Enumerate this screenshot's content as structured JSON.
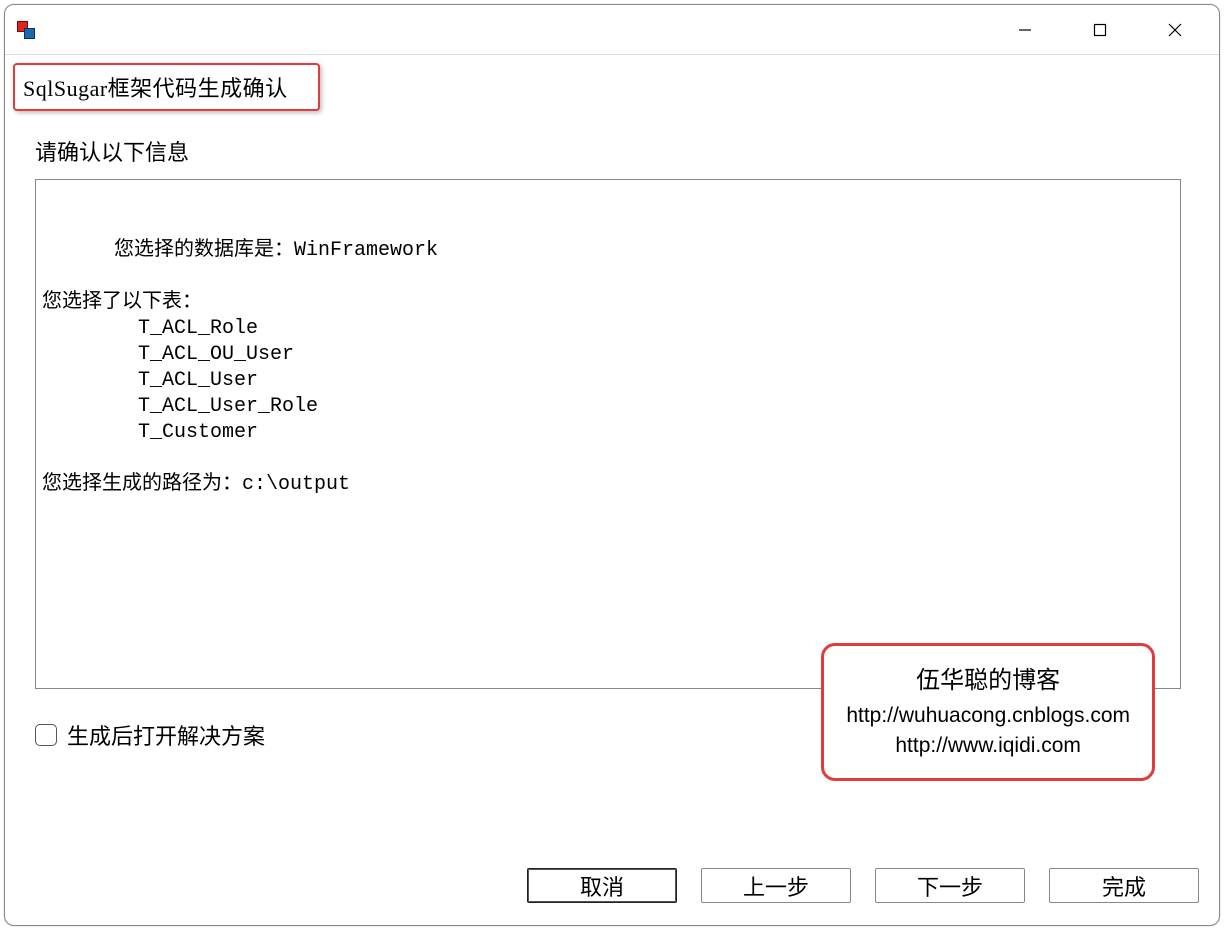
{
  "window": {
    "title": "SqlSugar框架代码生成确认"
  },
  "main": {
    "confirm_label": "请确认以下信息",
    "db_line": "您选择的数据库是：WinFramework",
    "tables_header": "您选择了以下表：",
    "tables": [
      "T_ACL_Role",
      "T_ACL_OU_User",
      "T_ACL_User",
      "T_ACL_User_Role",
      "T_Customer"
    ],
    "path_line": "您选择生成的路径为：c:\\output",
    "checkbox_label": "生成后打开解决方案"
  },
  "watermark": {
    "title": "伍华聪的博客",
    "line1": "http://wuhuacong.cnblogs.com",
    "line2": "http://www.iqidi.com"
  },
  "buttons": {
    "cancel": "取消",
    "prev": "上一步",
    "next": "下一步",
    "finish": "完成"
  }
}
